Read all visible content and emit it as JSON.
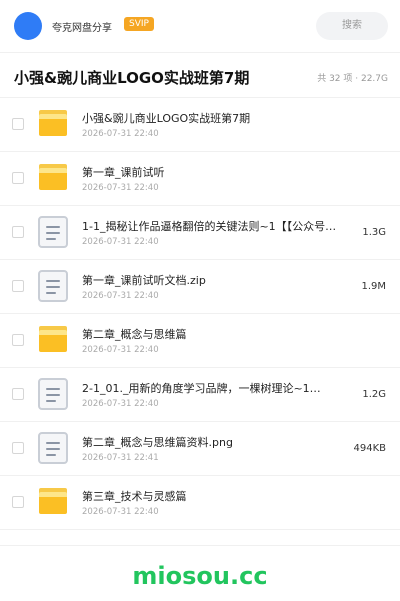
{
  "header": {
    "share_name": "夸克网盘分享",
    "badge": "SVIP",
    "search_placeholder": "搜索"
  },
  "folder": {
    "title": "小强&豌儿商业LOGO实战班第7期",
    "meta": "共 32 项 · 22.7G"
  },
  "files": [
    {
      "type": "folder",
      "name": "小强&豌儿商业LOGO实战班第7期",
      "date": "2026-07-31 22:40",
      "size": ""
    },
    {
      "type": "folder",
      "name": "第一章_课前试听",
      "date": "2026-07-31 22:40",
      "size": ""
    },
    {
      "type": "doc",
      "name": "1-1_揭秘让作品逼格翻倍的关键法则~1【【公众号…",
      "date": "2026-07-31 22:40",
      "size": "1.3G"
    },
    {
      "type": "doc",
      "name": "第一章_课前试听文档.zip",
      "date": "2026-07-31 22:40",
      "size": "1.9M"
    },
    {
      "type": "folder",
      "name": "第二章_概念与思维篇",
      "date": "2026-07-31 22:40",
      "size": ""
    },
    {
      "type": "doc",
      "name": "2-1_01._用新的角度学习品牌，一棵树理论~1…",
      "date": "2026-07-31 22:40",
      "size": "1.2G"
    },
    {
      "type": "doc",
      "name": "第二章_概念与思维篇资料.png",
      "date": "2026-07-31 22:41",
      "size": "494KB"
    },
    {
      "type": "folder",
      "name": "第三章_技术与灵感篇",
      "date": "2026-07-31 22:40",
      "size": ""
    }
  ],
  "watermark": "miosou.cc",
  "colors": {
    "accent": "#2f7cf6",
    "svip": "#f5a623",
    "folder": "#fbbf24",
    "watermark": "#22c55e"
  }
}
